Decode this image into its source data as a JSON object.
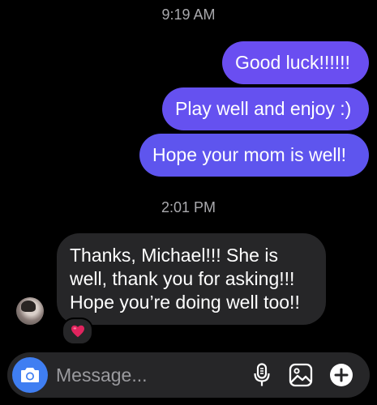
{
  "conversation": {
    "timestamps": [
      "9:19 AM",
      "2:01 PM"
    ],
    "outgoing": [
      "Good luck!!!!!!",
      "Play well and enjoy :)",
      "Hope your mom is well!"
    ],
    "incoming": {
      "lines": [
        "Thanks, Michael!!! She is",
        "well, thank you for asking!!!",
        "Hope you’re doing well too!!"
      ],
      "reaction": "❤️"
    },
    "avatar_icon": "contact-avatar"
  },
  "composer": {
    "placeholder": "Message...",
    "value": "",
    "icons": [
      "camera-icon",
      "microphone-icon",
      "gallery-icon",
      "plus-icon"
    ]
  },
  "colors": {
    "background": "#000000",
    "outgoing_bubble_top": "#6a4ef1",
    "outgoing_bubble_bottom": "#5e55ee",
    "incoming_bubble": "#262628",
    "camera_button": "#3f7ef2",
    "timestamp_text": "#a9a9ad",
    "reaction_heart": "#e0245e"
  }
}
